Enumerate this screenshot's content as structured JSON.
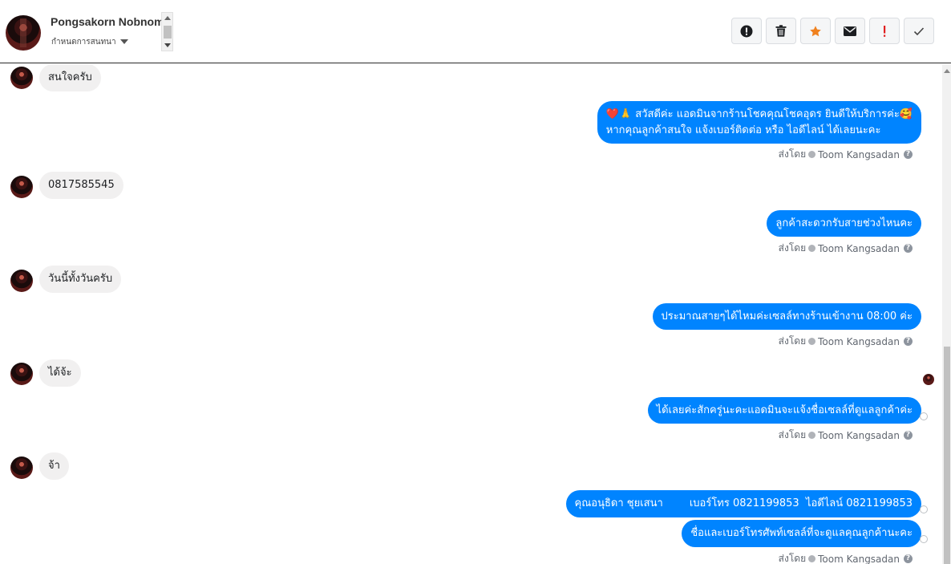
{
  "header": {
    "contact_name": "Pongsakorn Nobnom",
    "conversation_label": "กำหนดการสนทนา"
  },
  "toolbar": {
    "buttons": [
      {
        "icon": "alert-circle-icon"
      },
      {
        "icon": "trash-icon"
      },
      {
        "icon": "star-icon",
        "color": "#f0811f"
      },
      {
        "icon": "envelope-icon"
      },
      {
        "icon": "exclamation-icon",
        "color": "#e02020"
      },
      {
        "icon": "check-icon"
      }
    ]
  },
  "messages": [
    {
      "dir": "in",
      "text": "สนใจครับ"
    },
    {
      "dir": "out",
      "lines": [
        "❤️🙏 สวัสดีค่ะ แอดมินจากร้านโชคคุณโชคอุดร ยินดีให้บริการค่ะ🥰",
        "หากคุณลูกค้าสนใจ แจ้งเบอร์ติดต่อ หรือ ไอดีไลน์ ได้เลยนะคะ"
      ],
      "sent_by": "ส่งโดย",
      "agent": "Toom Kangsadan"
    },
    {
      "dir": "in",
      "text": "0817585545"
    },
    {
      "dir": "out",
      "lines": [
        "ลูกค้าสะดวกรับสายช่วงไหนคะ"
      ],
      "sent_by": "ส่งโดย",
      "agent": "Toom Kangsadan"
    },
    {
      "dir": "in",
      "text": "วันนี้ทั้งวันครับ"
    },
    {
      "dir": "out",
      "lines": [
        "ประมาณสายๆได้ไหมค่ะเซลล์ทางร้านเข้างาน 08:00 ค่ะ"
      ],
      "sent_by": "ส่งโดย",
      "agent": "Toom Kangsadan"
    },
    {
      "dir": "in",
      "text": "ได้จ้ะ"
    },
    {
      "dir": "out",
      "lines": [
        "ได้เลยค่ะสักครู่นะคะแอดมินจะแจ้งชื่อเซลล์ที่ดูแลลูกค้าค่ะ"
      ],
      "sent_by": "ส่งโดย",
      "agent": "Toom Kangsadan"
    },
    {
      "dir": "in",
      "text": "จ้า"
    },
    {
      "dir": "out",
      "lines": [
        "คุณอนุธิดา ชุยเสนา        เบอร์โทร 0821199853  ไอดีไลน์ 0821199853"
      ]
    },
    {
      "dir": "out",
      "lines": [
        "ชื่อและเบอร์โทรศัพท์เซลล์ที่จะดูแลคุณลูกค้านะคะ"
      ],
      "sent_by": "ส่งโดย",
      "agent": "Toom Kangsadan"
    }
  ],
  "colors": {
    "outgoing_bubble": "#0084ff",
    "incoming_bubble": "#f1f0f0"
  }
}
